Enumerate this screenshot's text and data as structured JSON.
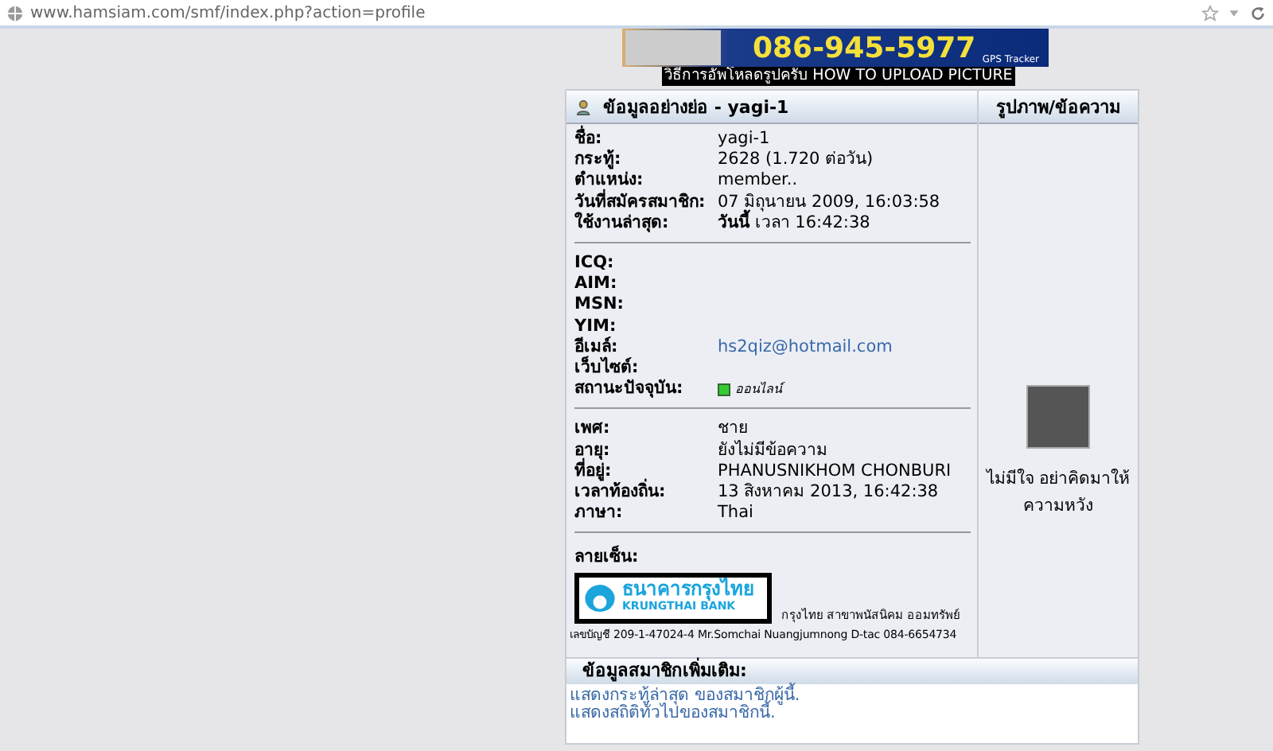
{
  "browser": {
    "url": "www.hamsiam.com/smf/index.php?action=profile"
  },
  "banner": {
    "phone": "086-945-5977",
    "tag": "GPS Tracker",
    "caption": "วิธีการอัพโหลดรูปครับ HOW TO UPLOAD PICTURE"
  },
  "profile": {
    "title": "ข้อมูลอย่างย่อ - yagi-1",
    "side_title": "รูปภาพ/ข้อความ",
    "sections": [
      [
        {
          "label": "ชื่อ:",
          "value": "yagi-1"
        },
        {
          "label": "กระทู้:",
          "value": "2628 (1.720 ต่อวัน)"
        },
        {
          "label": "ตำแหน่ง:",
          "value": "member.."
        },
        {
          "label": "วันที่สมัครสมาชิก:",
          "value": "07 มิถุนายน 2009, 16:03:58"
        },
        {
          "label": "ใช้งานล่าสุด:",
          "value": "**วันนี้** เวลา 16:42:38"
        }
      ],
      [
        {
          "label": "ICQ:"
        },
        {
          "label": "AIM:"
        },
        {
          "label": "MSN:"
        },
        {
          "label": "YIM:"
        },
        {
          "label": "อีเมล์:",
          "value": "hs2qiz@hotmail.com",
          "kind": "link"
        },
        {
          "label": "เว็บไซต์:"
        },
        {
          "label": "สถานะปัจจุบัน:",
          "value": "ออนไลน์",
          "kind": "status",
          "color": "#33cc33"
        }
      ],
      [
        {
          "label": "เพศ:",
          "value": "ชาย"
        },
        {
          "label": "อายุ:",
          "value": "ยังไม่มีข้อความ"
        },
        {
          "label": "ที่อยู่:",
          "value": "PHANUSNIKHOM CHONBURI"
        },
        {
          "label": "เวลาท้องถิ่น:",
          "value": "13 สิงหาคม 2013, 16:42:38"
        },
        {
          "label": "ภาษา:",
          "value": "Thai"
        }
      ]
    ],
    "signature": {
      "label": "ลายเซ็น:",
      "logo_thai": "ธนาคารกรุงไทย",
      "logo_en": "KRUNGTHAI BANK",
      "line_1": "กรุงไทย สาขาพนัสนิคม ออมทรัพย์",
      "line_2": "เลขบัญชี 209-1-47024-4  Mr.Somchai Nuangjumnong  D-tac  084-6654734"
    },
    "personal_text": "ไม่มีใจ อย่าคิดมาให้ความหวัง"
  },
  "additional": {
    "title": "ข้อมูลสมาชิกเพิ่มเติม:",
    "links": [
      "แสดงกระทู้ล่าสุด ของสมาชิกผู้นี้.",
      "แสดงสถิติทั่วไปของสมาชิกนี้."
    ]
  }
}
